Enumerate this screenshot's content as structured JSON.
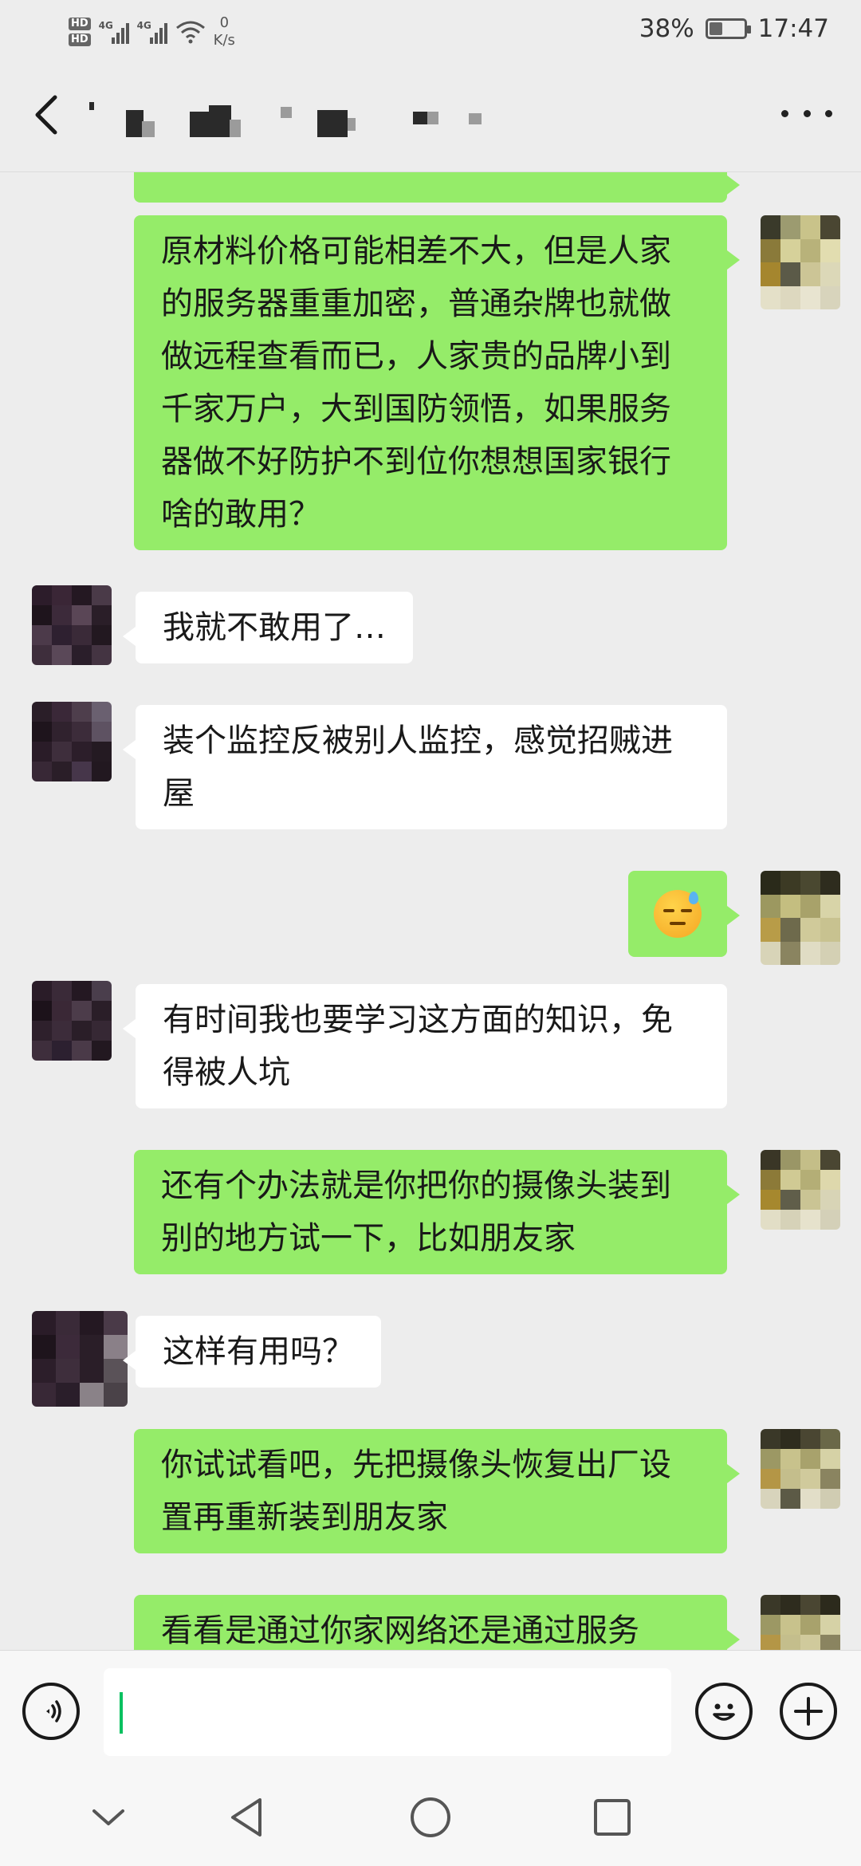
{
  "status_bar": {
    "hd1": "HD",
    "hd2": "HD",
    "net1": "4G",
    "net2": "4G",
    "speed_value": "0",
    "speed_unit": "K/s",
    "battery_text": "38%",
    "battery_level": 0.38,
    "time": "17:47"
  },
  "header": {
    "title": ""
  },
  "messages": [
    {
      "side": "me",
      "text": "原材料价格可能相差不大，但是人家的服务器重重加密，普通杂牌也就做做远程查看而已，人家贵的品牌小到千家万户，大到国防领悟，如果服务器做不好防护不到位你想想国家银行啥的敢用？"
    },
    {
      "side": "them",
      "text": "我就不敢用了…"
    },
    {
      "side": "them",
      "text": "装个监控反被别人监控，感觉招贼进屋"
    },
    {
      "side": "me",
      "emoji": "downcast-face-with-sweat"
    },
    {
      "side": "them",
      "text": "有时间我也要学习这方面的知识，免得被人坑"
    },
    {
      "side": "me",
      "text": "还有个办法就是你把你的摄像头装到别的地方试一下，比如朋友家"
    },
    {
      "side": "them",
      "text": "这样有用吗？"
    },
    {
      "side": "me",
      "text": "你试试看吧，先把摄像头恢复出厂设置再重新装到朋友家"
    },
    {
      "side": "me",
      "text": "看看是通过你家网络还是通过服务"
    }
  ],
  "input": {
    "value": ""
  },
  "icons": {
    "back": "chevron-left-icon",
    "more": "more-dots-icon",
    "voice": "voice-icon",
    "emoji": "smiley-icon",
    "plus": "plus-icon",
    "nav_down": "chevron-down-icon",
    "nav_back": "triangle-back-icon",
    "nav_home": "circle-home-icon",
    "nav_recents": "square-recents-icon"
  },
  "colors": {
    "my_bubble": "#95ec69",
    "their_bubble": "#ffffff",
    "background": "#ededed",
    "caret": "#07c160"
  }
}
